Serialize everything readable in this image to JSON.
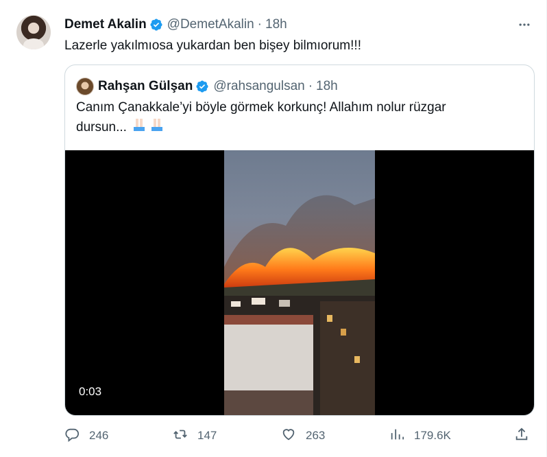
{
  "tweet": {
    "author_name": "Demet Akalin",
    "handle": "@DemetAkalin",
    "separator": "·",
    "time": "18h",
    "text": "Lazerle yakılmıosa yukardan ben bişey bilmıorum!!!"
  },
  "quoted": {
    "author_name": "Rahşan Gülşan",
    "handle": "@rahsangulsan",
    "separator": "·",
    "time": "18h",
    "text_line1": "Canım Çanakkale’yi böyle görmek korkunç! Allahım nolur rüzgar",
    "text_line2": "dursun...",
    "video_duration": "0:03"
  },
  "actions": {
    "replies": "246",
    "retweets": "147",
    "likes": "263",
    "views": "179.6K"
  },
  "icons": {
    "verified": "verified-badge-icon",
    "more": "more-icon",
    "reply": "reply-icon",
    "retweet": "retweet-icon",
    "like": "heart-icon",
    "views": "views-icon",
    "share": "share-icon",
    "praying_hands": "praying-hands-emoji"
  },
  "colors": {
    "verified": "#1d9bf0",
    "text": "#0f1419",
    "secondary": "#536471",
    "border": "#cfd9de"
  }
}
